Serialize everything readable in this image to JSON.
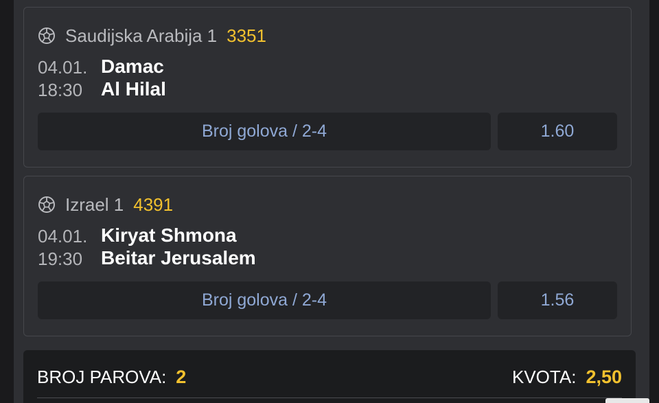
{
  "matches": [
    {
      "league": "Saudijska Arabija 1",
      "code": "3351",
      "date": "04.01.",
      "time": "18:30",
      "home": "Damac",
      "away": "Al Hilal",
      "bet": "Broj golova / 2-4",
      "odd": "1.60",
      "icon": "soccer-ball-icon"
    },
    {
      "league": "Izrael 1",
      "code": "4391",
      "date": "04.01.",
      "time": "19:30",
      "home": "Kiryat Shmona",
      "away": "Beitar Jerusalem",
      "bet": "Broj golova / 2-4",
      "odd": "1.56",
      "icon": "soccer-ball-icon"
    }
  ],
  "summary": {
    "pairs_label": "BROJ PAROVA:",
    "pairs_value": "2",
    "odds_label": "KVOTA:",
    "odds_value": "2,50"
  },
  "colors": {
    "accent": "#f2c12e",
    "bet_text": "#8fa8d4",
    "card_bg": "#2e2f33",
    "button_bg": "#222326"
  }
}
